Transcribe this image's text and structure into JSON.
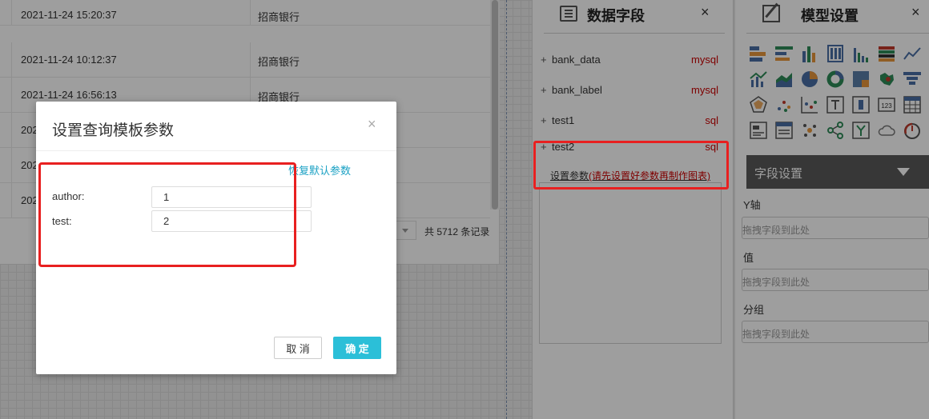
{
  "table": {
    "rows": [
      {
        "time": "2021-11-24 15:20:37",
        "bank": "招商银行"
      },
      {
        "time": "2021-11-24 10:12:37",
        "bank": "招商银行"
      },
      {
        "time": "2021-11-24 16:56:13",
        "bank": "招商银行"
      },
      {
        "time": "202",
        "bank": ""
      },
      {
        "time": "202",
        "bank": ""
      },
      {
        "time": "202",
        "bank": ""
      }
    ],
    "total_records": "共 5712 条记录"
  },
  "field_panel": {
    "title": "数据字段",
    "close": "×",
    "datasets": [
      {
        "name": "bank_data",
        "type": "mysql"
      },
      {
        "name": "bank_label",
        "type": "mysql"
      },
      {
        "name": "test1",
        "type": "sql"
      },
      {
        "name": "test2",
        "type": "sql"
      }
    ],
    "param_link": "设置参数",
    "param_warning": "(请先设置好参数再制作图表)"
  },
  "model_panel": {
    "title": "模型设置",
    "close": "×",
    "field_settings": "字段设置",
    "axes": [
      {
        "label": "Y轴",
        "placeholder": "拖拽字段到此处"
      },
      {
        "label": "值",
        "placeholder": "拖拽字段到此处"
      },
      {
        "label": "分组",
        "placeholder": "拖拽字段到此处"
      }
    ]
  },
  "modal": {
    "title": "设置查询模板参数",
    "close": "×",
    "restore_link": "恢复默认参数",
    "params": [
      {
        "label": "author:",
        "value": "1"
      },
      {
        "label": "test:",
        "value": "2"
      }
    ],
    "cancel_label": "取 消",
    "ok_label": "确 定"
  },
  "colors": {
    "accent": "#2bbfd8",
    "link": "#1aa1c4",
    "warning": "#cc0000",
    "highlight_box": "#e82020"
  }
}
